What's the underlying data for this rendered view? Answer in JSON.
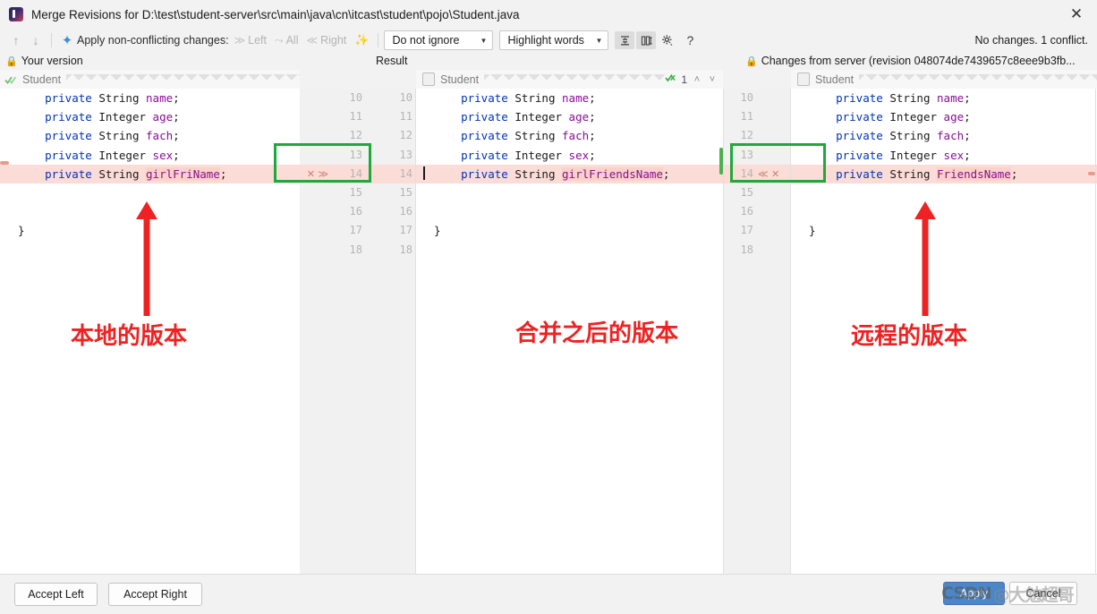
{
  "window": {
    "title": "Merge Revisions for D:\\test\\student-server\\src\\main\\java\\cn\\itcast\\student\\pojo\\Student.java",
    "app_icon": "intellij-idea-icon",
    "close_label": "✕"
  },
  "toolbar": {
    "prev_icon": "arrow-up-icon",
    "next_icon": "arrow-down-icon",
    "magic_icon": "apply-non-conflicting-icon",
    "apply_label": "Apply non-conflicting changes:",
    "left_label": "Left",
    "left_glyph": "≫",
    "all_label": "All",
    "all_glyph": "⤳",
    "right_label": "Right",
    "right_glyph": "≪",
    "wand_icon": "magic-wand-icon",
    "ignore_select": "Do not ignore",
    "highlight_select": "Highlight words",
    "collapse_icon": "collapse-unchanged-icon",
    "columns_icon": "side-by-side-icon",
    "settings_icon": "gear-icon",
    "help_icon": "help-icon",
    "help_label": "?",
    "status": "No changes. 1 conflict.",
    "caret_glyph": "▼"
  },
  "panes": {
    "left": {
      "header": "Your version",
      "lock_icon": "lock-icon",
      "breadcrumb": "Student",
      "breadcrumb_icon": "checkmark-double-icon"
    },
    "middle": {
      "header": "Result",
      "breadcrumb": "Student",
      "breadcrumb_icon": "file-icon",
      "conflict_count": "1",
      "conflict_icon": "conflict-check-icon",
      "up_icon": "chevron-up-icon",
      "down_icon": "chevron-down-icon",
      "up_glyph": "˄",
      "down_glyph": "˅"
    },
    "right": {
      "header": "Changes from server (revision 048074de7439657c8eee9b3fb...",
      "lock_icon": "lock-icon",
      "breadcrumb": "Student",
      "breadcrumb_icon": "file-icon",
      "check_icon": "checkmark-icon"
    }
  },
  "code": {
    "left_lines": [
      {
        "indent": "    ",
        "kw": "private",
        "type": "String",
        "name": "name",
        "tail": ";",
        "conflict": false
      },
      {
        "indent": "    ",
        "kw": "private",
        "type": "Integer",
        "name": "age",
        "tail": ";",
        "conflict": false
      },
      {
        "indent": "    ",
        "kw": "private",
        "type": "String",
        "name": "fach",
        "tail": ";",
        "conflict": false
      },
      {
        "indent": "    ",
        "kw": "private",
        "type": "Integer",
        "name": "sex",
        "tail": ";",
        "conflict": false
      },
      {
        "indent": "    ",
        "kw": "private",
        "type": "String",
        "name": "girlFriName",
        "tail": ";",
        "conflict": true
      },
      {
        "blank": true
      },
      {
        "blank": true
      },
      {
        "raw": "}"
      },
      {
        "blank": true
      }
    ],
    "middle_lines": [
      {
        "indent": "    ",
        "kw": "private",
        "type": "String",
        "name": "name",
        "tail": ";",
        "conflict": false
      },
      {
        "indent": "    ",
        "kw": "private",
        "type": "Integer",
        "name": "age",
        "tail": ";",
        "conflict": false
      },
      {
        "indent": "    ",
        "kw": "private",
        "type": "String",
        "name": "fach",
        "tail": ";",
        "conflict": false
      },
      {
        "indent": "    ",
        "kw": "private",
        "type": "Integer",
        "name": "sex",
        "tail": ";",
        "conflict": false
      },
      {
        "indent": "    ",
        "kw": "private",
        "type": "String",
        "name": "girlFriendsName",
        "tail": ";",
        "conflict": true
      },
      {
        "blank": true
      },
      {
        "blank": true
      },
      {
        "raw": "}"
      },
      {
        "blank": true
      }
    ],
    "right_lines": [
      {
        "indent": "    ",
        "kw": "private",
        "type": "String",
        "name": "name",
        "tail": ";",
        "conflict": false
      },
      {
        "indent": "    ",
        "kw": "private",
        "type": "Integer",
        "name": "age",
        "tail": ";",
        "conflict": false
      },
      {
        "indent": "    ",
        "kw": "private",
        "type": "String",
        "name": "fach",
        "tail": ";",
        "conflict": false
      },
      {
        "indent": "    ",
        "kw": "private",
        "type": "Integer",
        "name": "sex",
        "tail": ";",
        "conflict": false
      },
      {
        "indent": "    ",
        "kw": "private",
        "type": "String",
        "name": "FriendsName",
        "tail": ";",
        "conflict": true
      },
      {
        "blank": true
      },
      {
        "blank": true
      },
      {
        "raw": "}"
      },
      {
        "blank": true
      }
    ],
    "line_numbers": [
      "10",
      "11",
      "12",
      "13",
      "14",
      "15",
      "16",
      "17",
      "18"
    ],
    "left_gutter_actions": [
      "",
      "",
      "",
      "",
      "✕ ≫",
      "",
      "",
      "",
      ""
    ],
    "right_gutter_actions": [
      "",
      "",
      "",
      "",
      "≪ ✕",
      "",
      "",
      "",
      ""
    ]
  },
  "annotations": {
    "left_label": "本地的版本",
    "middle_label": "合并之后的版本",
    "right_label": "远程的版本",
    "arrow_icon": "red-arrow-up-icon",
    "box_icon": "green-highlight-box"
  },
  "footer": {
    "accept_left": "Accept Left",
    "accept_right": "Accept Right",
    "apply": "Apply",
    "cancel": "Cancel"
  },
  "watermark": {
    "brand": "CSDN",
    "handle": "@大勉超哥"
  },
  "colors": {
    "accent": "#4a86c8",
    "annotation_red": "#ee2222",
    "annotation_green": "#1fa83c",
    "conflict_bg": "#fbdcd6",
    "keyword": "#0033b3",
    "identifier": "#871094"
  }
}
